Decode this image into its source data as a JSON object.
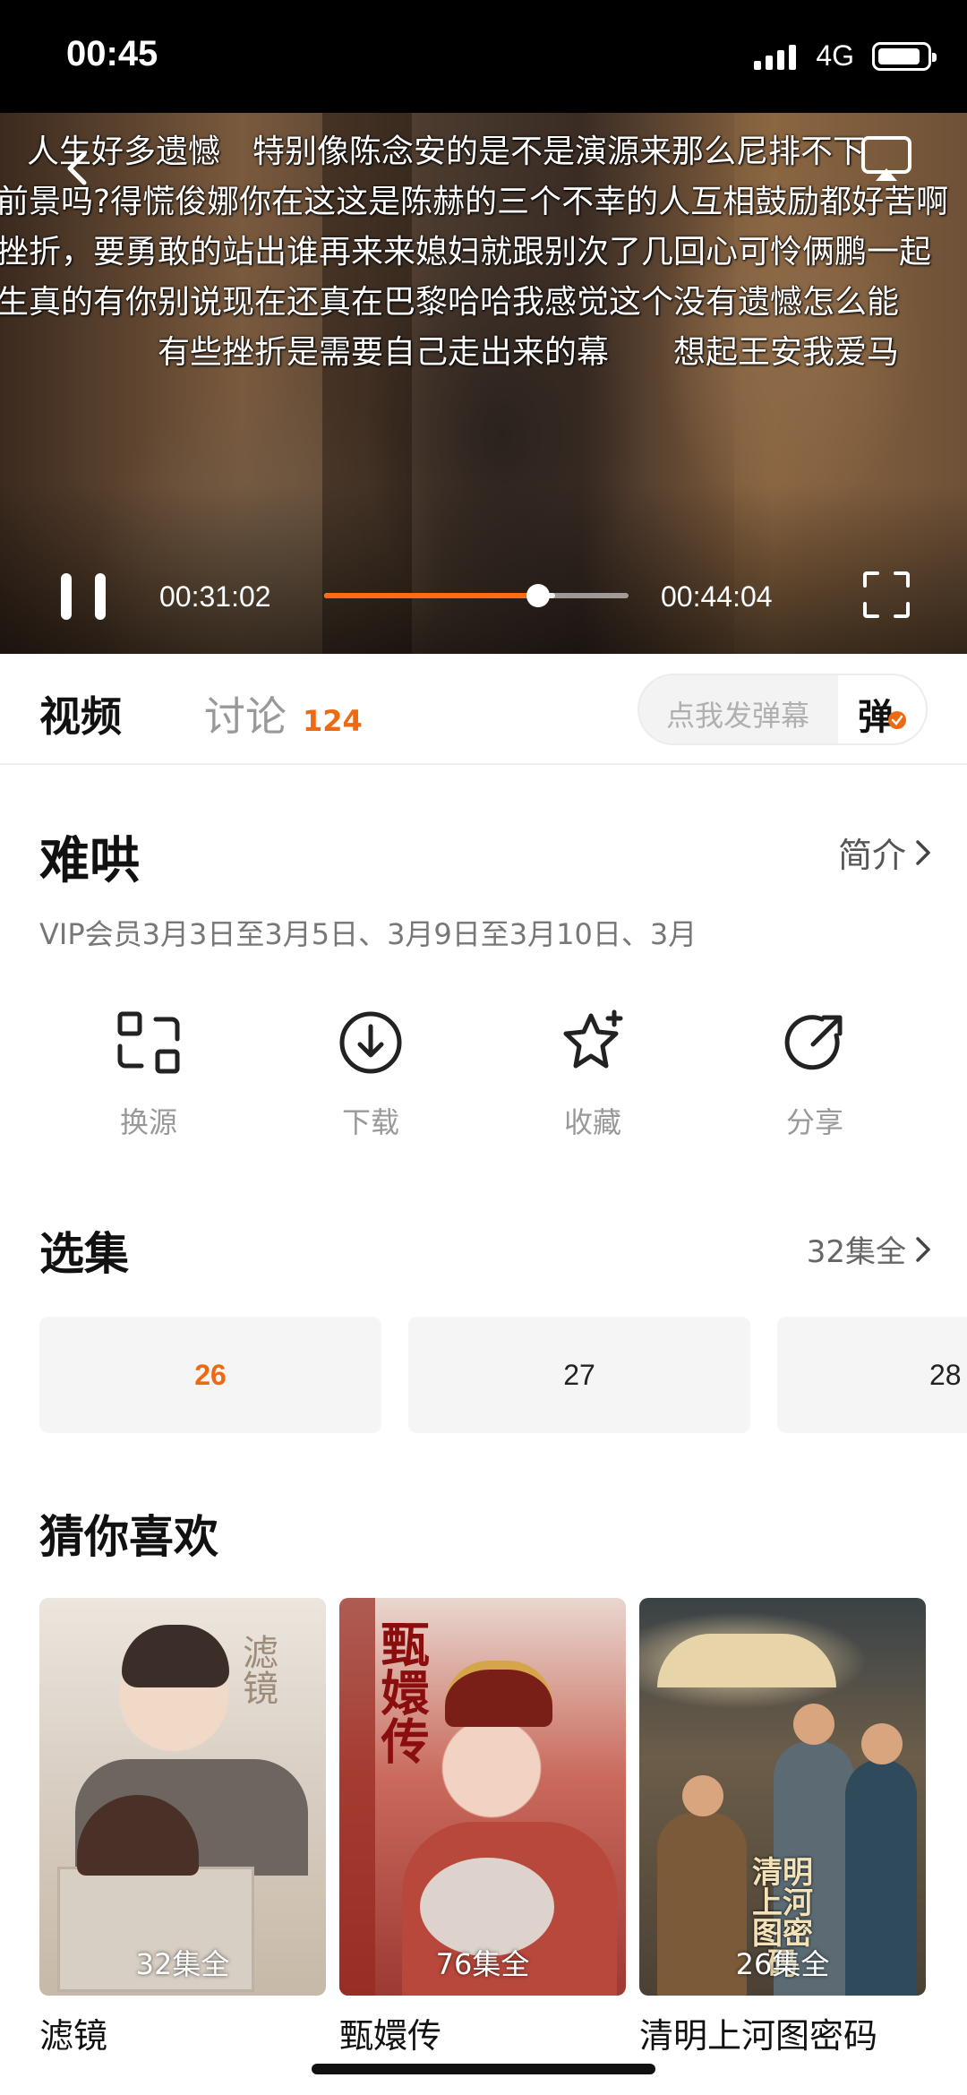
{
  "status_bar": {
    "time": "00:45",
    "network": "4G"
  },
  "player": {
    "danmaku": [
      "人生好多遗憾　特别像陈念安的是不是演源来那么尼排不下",
      "前景吗?得慌俊娜你在这这是陈赫的三个不幸的人互相鼓励都好苦啊",
      "挫折，要勇敢的站出谁再来来媳妇就跟别次了几回心可怜俩鹏一起",
      "生真的有你别说现在还真在巴黎哈哈我感觉这个没有遗憾怎么能",
      "有些挫折是需要自己走出来的幕　　想起王安我爱马"
    ],
    "current_time": "00:31:02",
    "total_time": "00:44:04",
    "progress": 0.704,
    "buffered": 0.76
  },
  "tabs": {
    "video_label": "视频",
    "discuss_label": "讨论",
    "discuss_count": "124",
    "danmaku_placeholder": "点我发弹幕",
    "danmaku_button": "弹"
  },
  "show": {
    "title": "难哄",
    "intro_label": "简介",
    "vip_note": "VIP会员3月3日至3月5日、3月9日至3月10日、3月"
  },
  "actions": [
    {
      "label": "换源",
      "icon": "switch-source-icon"
    },
    {
      "label": "下载",
      "icon": "download-icon"
    },
    {
      "label": "收藏",
      "icon": "favorite-star-icon"
    },
    {
      "label": "分享",
      "icon": "share-icon"
    }
  ],
  "episodes": {
    "title": "选集",
    "all_label": "32集全",
    "items": [
      "26",
      "27",
      "28"
    ],
    "active": "26"
  },
  "recommend": {
    "title": "猜你喜欢",
    "items": [
      {
        "name": "滤镜",
        "count": "32集全",
        "poster_text": "滤镜"
      },
      {
        "name": "甄嬛传",
        "count": "76集全",
        "poster_text": "甄嬛传"
      },
      {
        "name": "清明上河图密码",
        "count": "26集全",
        "poster_text": "清明上河图密码"
      }
    ]
  },
  "colors": {
    "accent": "#ee6a12",
    "progress": "#ff6a13"
  }
}
